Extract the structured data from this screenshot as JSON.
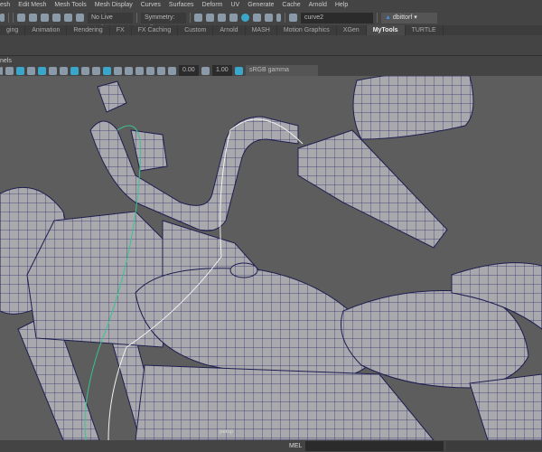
{
  "menu": [
    "esh",
    "Edit Mesh",
    "Mesh Tools",
    "Mesh Display",
    "Curves",
    "Surfaces",
    "Deform",
    "UV",
    "Generate",
    "Cache",
    "Arnold",
    "Help"
  ],
  "status": {
    "live_surface": "No Live Surface",
    "symmetry": "Symmetry: Off",
    "name_field": "curve2",
    "user": "dbittorf"
  },
  "tabs": [
    "ging",
    "Animation",
    "Rendering",
    "FX",
    "FX Caching",
    "Custom",
    "Arnold",
    "MASH",
    "Motion Graphics",
    "XGen",
    "MyTools",
    "TURTLE"
  ],
  "active_tab": "MyTools",
  "panels_label": "nels",
  "viewport_toolbar": {
    "exposure": "0.00",
    "gamma": "1.00",
    "color_space": "sRGB gamma"
  },
  "viewport": {
    "persp_label": "persp"
  },
  "command_line": {
    "label": "MEL",
    "value": ""
  }
}
